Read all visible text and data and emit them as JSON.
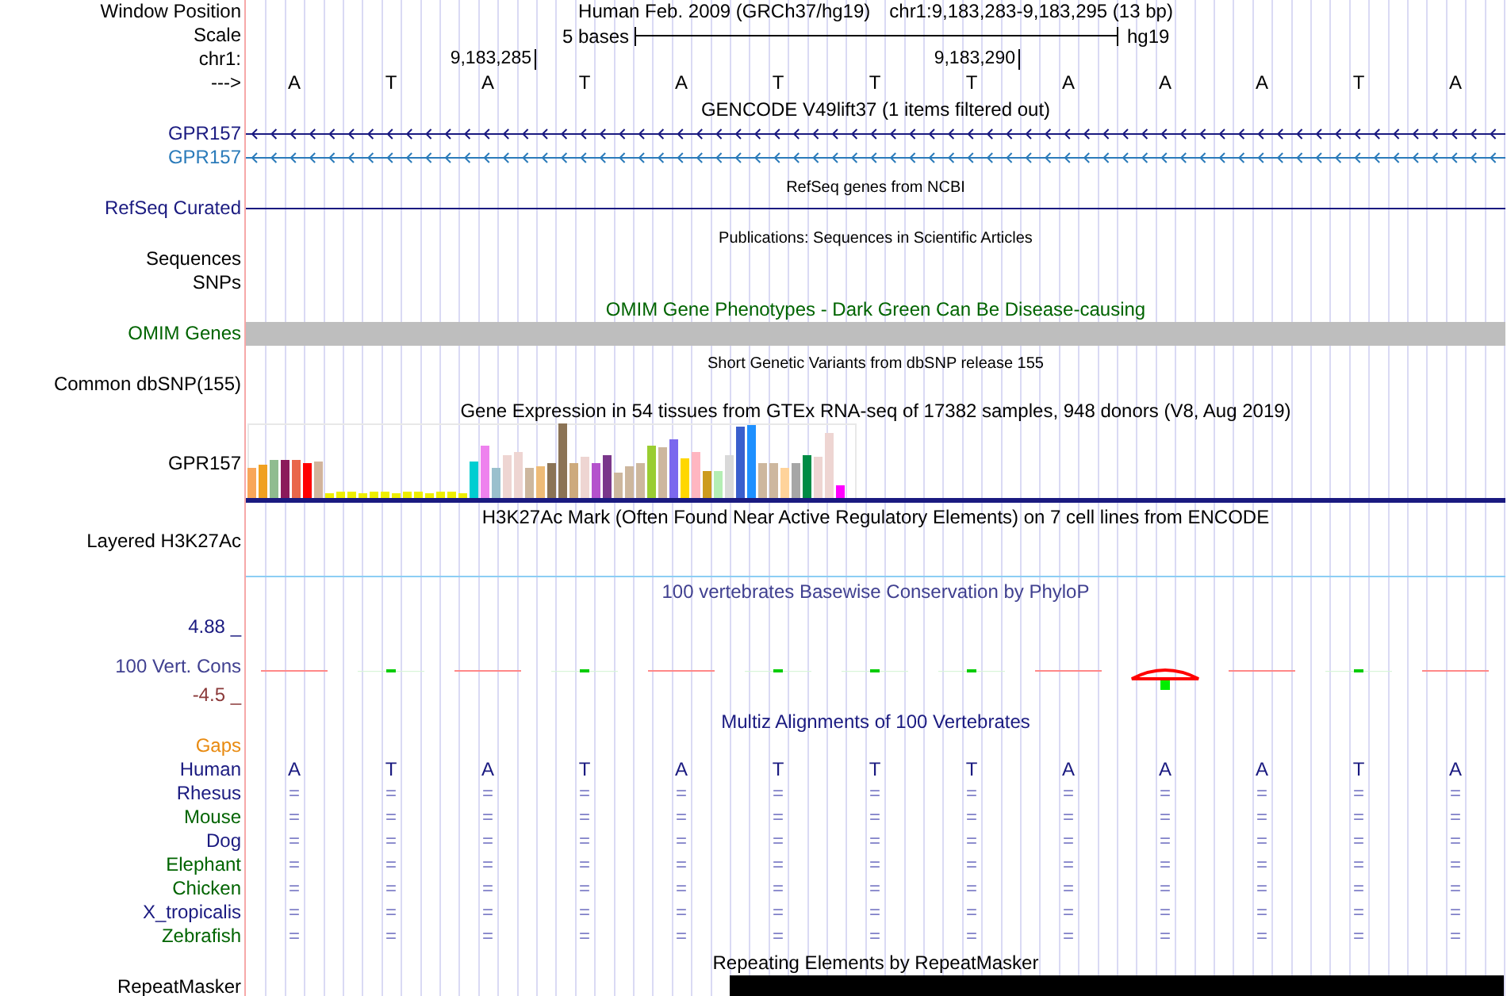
{
  "position": {
    "label": "Window Position",
    "assembly": "Human Feb. 2009 (GRCh37/hg19)",
    "range": "chr1:9,183,283-9,183,295 (13 bp)"
  },
  "scale": {
    "label": "Scale",
    "length": "5 bases",
    "assembly": "hg19"
  },
  "ruler": {
    "label": "chr1:"
  },
  "sequence": {
    "label": "--->",
    "bases": [
      {
        "letter": "A"
      },
      {
        "letter": "T"
      },
      {
        "letter": "A",
        "ruler_tick": "9,183,285"
      },
      {
        "letter": "T"
      },
      {
        "letter": "A"
      },
      {
        "letter": "T"
      },
      {
        "letter": "T"
      },
      {
        "letter": "T",
        "ruler_tick": "9,183,290"
      },
      {
        "letter": "A"
      },
      {
        "letter": "A"
      },
      {
        "letter": "A"
      },
      {
        "letter": "T"
      },
      {
        "letter": "A"
      }
    ]
  },
  "tracks": [
    {
      "kind": "genes",
      "title": "GENCODE V49lift37 (1 items filtered out)",
      "small_title": false,
      "items": [
        {
          "label": "GPR157",
          "color": "#1a1a80"
        },
        {
          "label": "GPR157",
          "color": "#2b7bba"
        }
      ]
    },
    {
      "kind": "line",
      "title": "RefSeq genes from NCBI",
      "small_title": true,
      "labels": [
        "RefSeq Curated"
      ]
    },
    {
      "kind": "empty",
      "title": "Publications: Sequences in Scientific Articles",
      "small_title": true,
      "labels": [
        "Sequences",
        "SNPs"
      ]
    },
    {
      "kind": "bar",
      "title": "OMIM Gene Phenotypes - Dark Green Can Be Disease-causing",
      "small_title": false,
      "labels": [
        "OMIM Genes"
      ]
    },
    {
      "kind": "empty",
      "title": "Short Genetic Variants from dbSNP release 155",
      "small_title": true,
      "labels": [
        "Common dbSNP(155)"
      ]
    },
    {
      "kind": "expression",
      "title": "Gene Expression in 54 tissues from GTEx RNA-seq of 17382 samples, 948 donors (V8, Aug 2019)",
      "small_title": false,
      "labels": [
        "GPR157"
      ]
    },
    {
      "kind": "layered",
      "title": "H3K27Ac Mark (Often Found Near Active Regulatory Elements) on 7 cell lines from ENCODE",
      "small_title": false,
      "labels": [
        "Layered H3K27Ac"
      ]
    },
    {
      "kind": "conservation",
      "title": "100 vertebrates Basewise Conservation by PhyloP",
      "small_title": false,
      "labels": [
        "4.88 _",
        "100 Vert. Cons",
        "-4.5 _"
      ]
    },
    {
      "kind": "alignment",
      "title": "Multiz Alignments of 100 Vertebrates",
      "small_title": false,
      "labels": [
        "Gaps"
      ],
      "species": [
        {
          "name": "Human",
          "color": "#1a1a80",
          "bases": [
            "A",
            "T",
            "A",
            "T",
            "A",
            "T",
            "T",
            "T",
            "A",
            "A",
            "A",
            "T",
            "A"
          ]
        },
        {
          "name": "Rhesus",
          "color": "#1a1a80",
          "bases": [
            "=",
            "=",
            "=",
            "=",
            "=",
            "=",
            "=",
            "=",
            "=",
            "=",
            "=",
            "=",
            "="
          ]
        },
        {
          "name": "Mouse",
          "color": "#006400",
          "bases": [
            "=",
            "=",
            "=",
            "=",
            "=",
            "=",
            "=",
            "=",
            "=",
            "=",
            "=",
            "=",
            "="
          ]
        },
        {
          "name": "Dog",
          "color": "#1a1a80",
          "bases": [
            "=",
            "=",
            "=",
            "=",
            "=",
            "=",
            "=",
            "=",
            "=",
            "=",
            "=",
            "=",
            "="
          ]
        },
        {
          "name": "Elephant",
          "color": "#006400",
          "bases": [
            "=",
            "=",
            "=",
            "=",
            "=",
            "=",
            "=",
            "=",
            "=",
            "=",
            "=",
            "=",
            "="
          ]
        },
        {
          "name": "Chicken",
          "color": "#006400",
          "bases": [
            "=",
            "=",
            "=",
            "=",
            "=",
            "=",
            "=",
            "=",
            "=",
            "=",
            "=",
            "=",
            "="
          ]
        },
        {
          "name": "X_tropicalis",
          "color": "#1a1a80",
          "bases": [
            "=",
            "=",
            "=",
            "=",
            "=",
            "=",
            "=",
            "=",
            "=",
            "=",
            "=",
            "=",
            "="
          ]
        },
        {
          "name": "Zebrafish",
          "color": "#006400",
          "bases": [
            "=",
            "=",
            "=",
            "=",
            "=",
            "=",
            "=",
            "=",
            "=",
            "=",
            "=",
            "=",
            "="
          ]
        }
      ]
    },
    {
      "kind": "repeat",
      "title": "Repeating Elements by RepeatMasker",
      "small_title": false,
      "labels": [
        "RepeatMasker"
      ]
    }
  ]
}
